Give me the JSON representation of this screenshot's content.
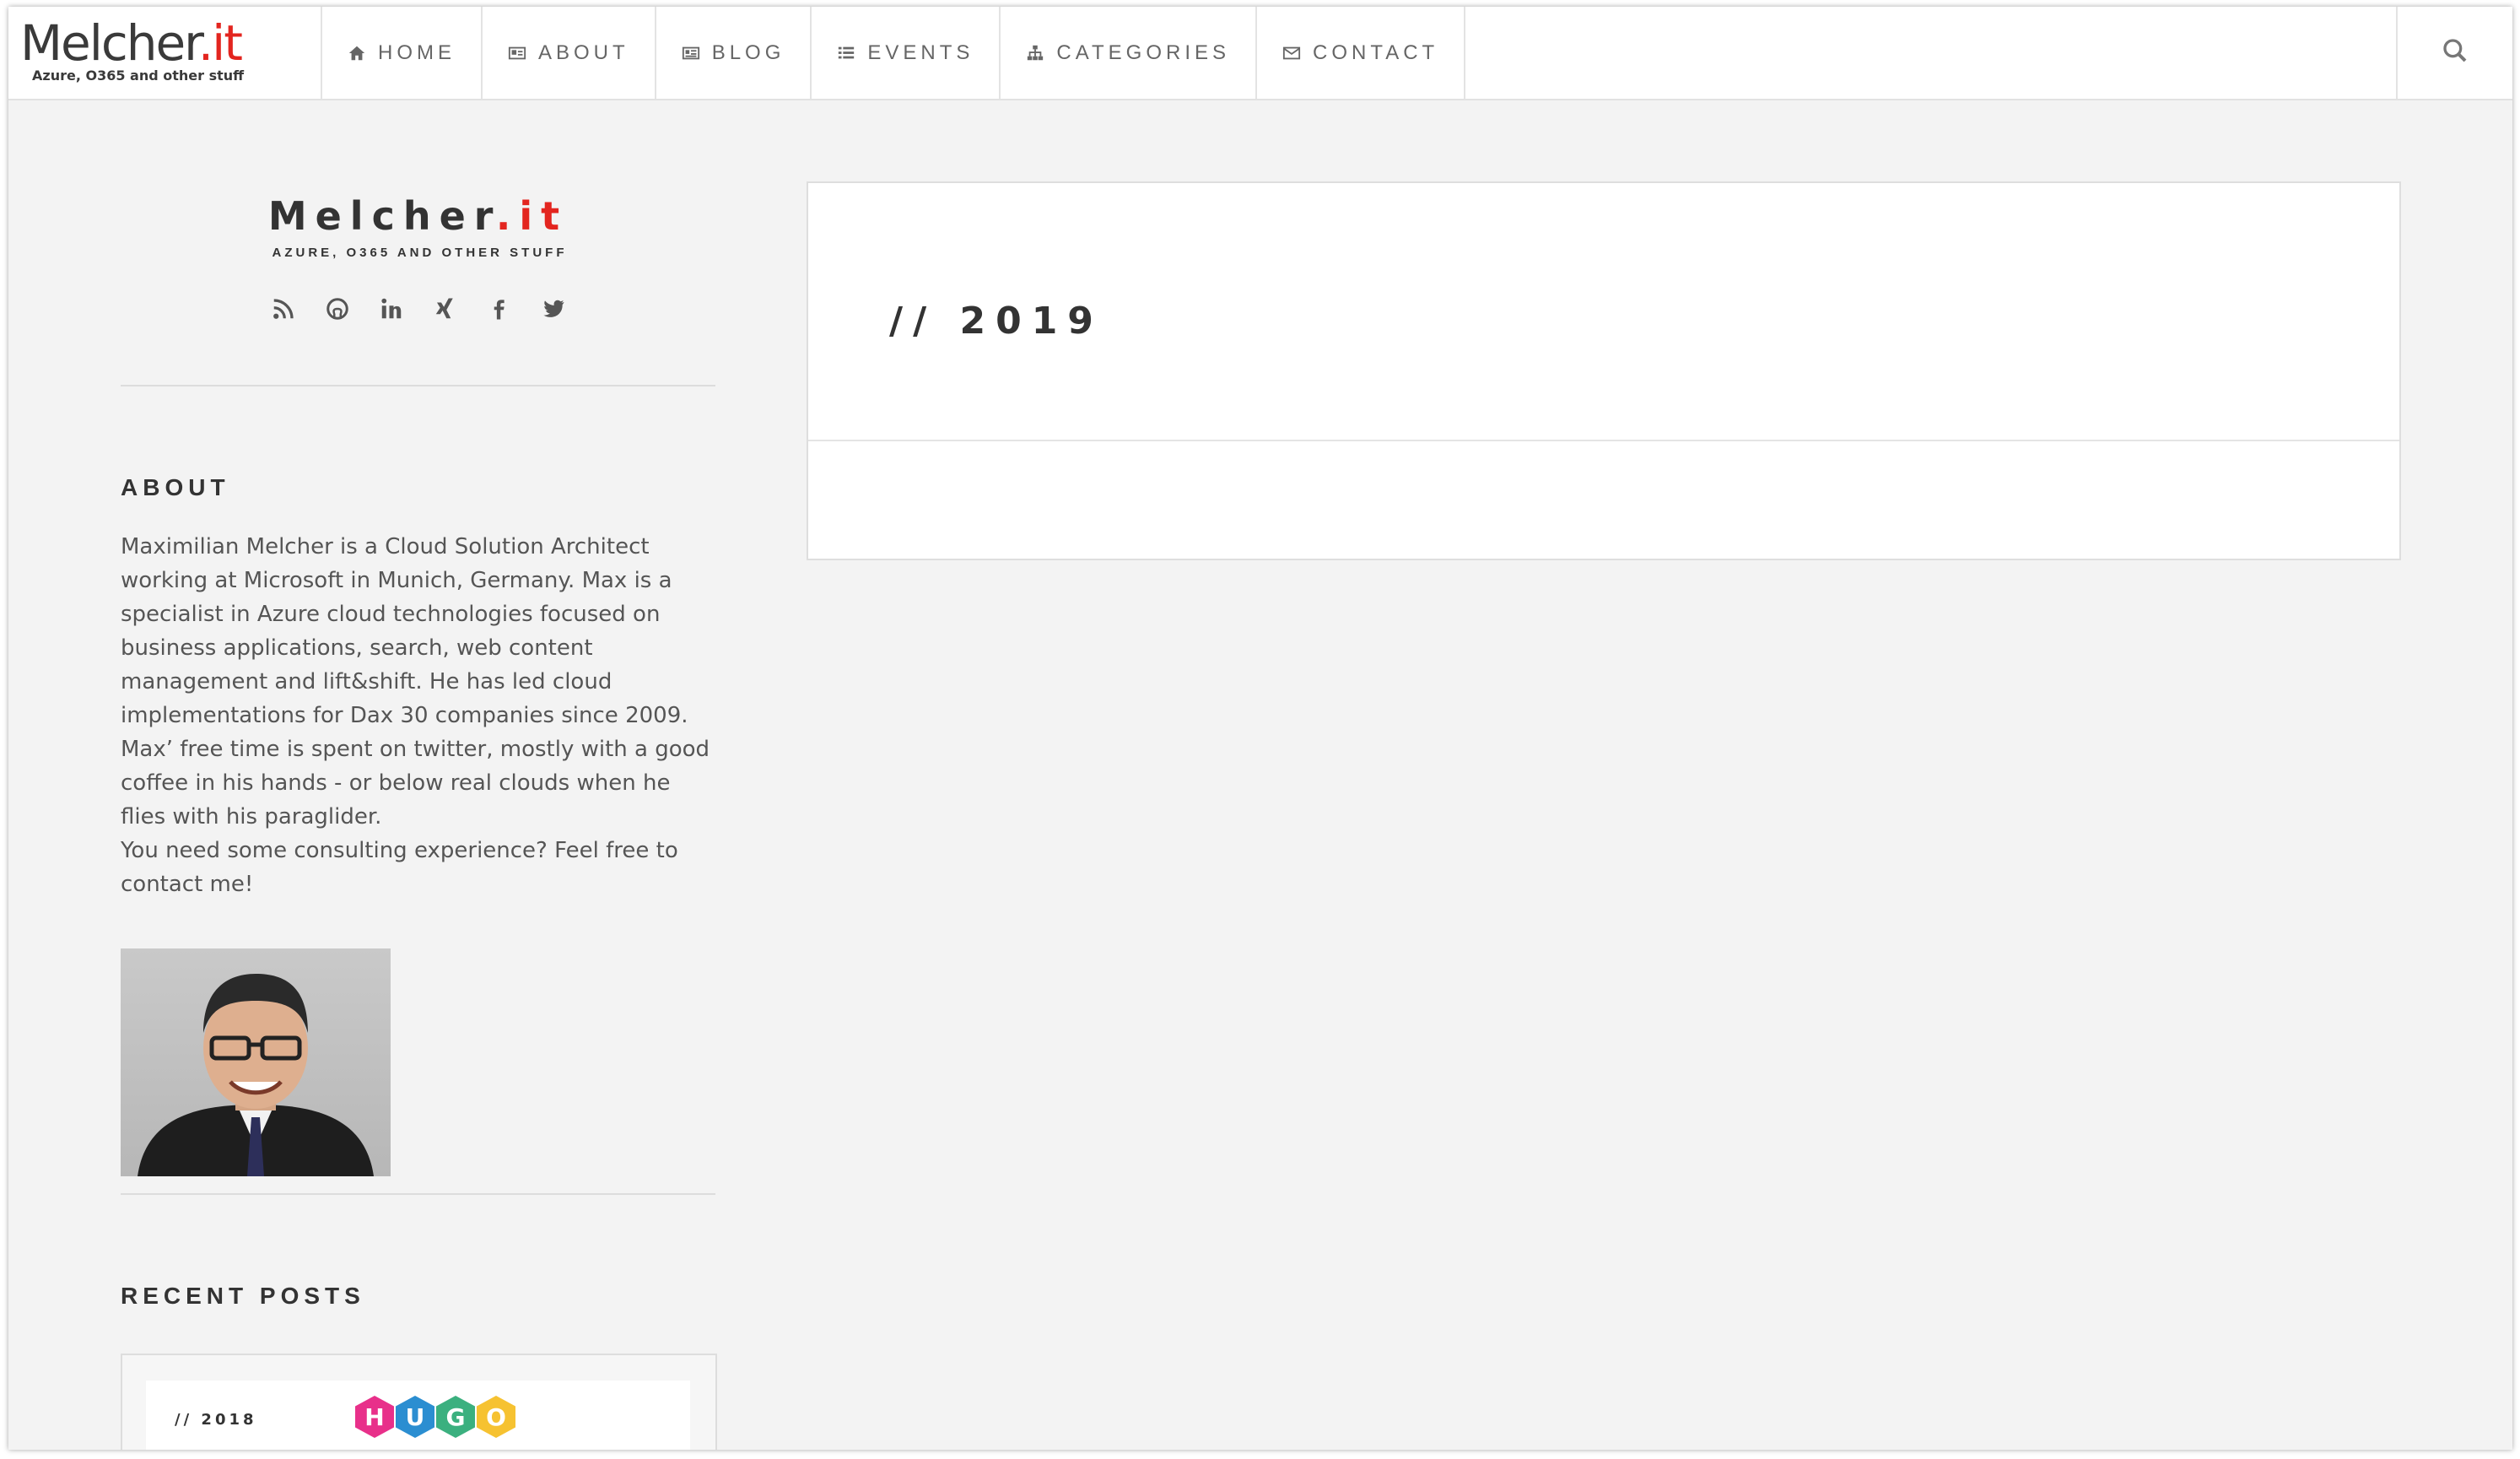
{
  "brand": {
    "name_main": "Melcher",
    "name_accent": ".it",
    "tagline": "Azure, O365 and other stuff"
  },
  "nav": {
    "items": [
      {
        "label": "HOME",
        "icon": "home-icon"
      },
      {
        "label": "ABOUT",
        "icon": "id-card-icon"
      },
      {
        "label": "BLOG",
        "icon": "newspaper-icon"
      },
      {
        "label": "EVENTS",
        "icon": "list-icon"
      },
      {
        "label": "CATEGORIES",
        "icon": "sitemap-icon"
      },
      {
        "label": "CONTACT",
        "icon": "envelope-icon"
      }
    ],
    "search_icon": "search-icon"
  },
  "sidebar": {
    "brand_main": "Melcher",
    "brand_accent": ".it",
    "tagline": "AZURE, O365 AND OTHER STUFF",
    "social": [
      "rss-icon",
      "github-icon",
      "linkedin-icon",
      "xing-icon",
      "facebook-icon",
      "twitter-icon"
    ],
    "about_title": "ABOUT",
    "about_text": "Maximilian Melcher is a Cloud Solution Architect working at Microsoft in Munich, Germany. Max is a specialist in Azure cloud technologies focused on business applications, search, web content management and lift&shift. He has led cloud implementations for Dax 30 companies since 2009. Max’ free time is spent on twitter, mostly with a good coffee in his hands - or below real clouds when he flies with his paraglider.",
    "about_text_2": "You need some consulting experience? Feel free to contact me!",
    "recent_title": "RECENT POSTS",
    "recent_post": {
      "year": "// 2018",
      "logo_letters": [
        "H",
        "U",
        "G",
        "O"
      ]
    }
  },
  "main": {
    "title": "// 2019"
  },
  "colors": {
    "accent": "#e3251f",
    "hugo": [
      "#e8308a",
      "#2b8ed1",
      "#3bb07f",
      "#f6c231"
    ]
  }
}
